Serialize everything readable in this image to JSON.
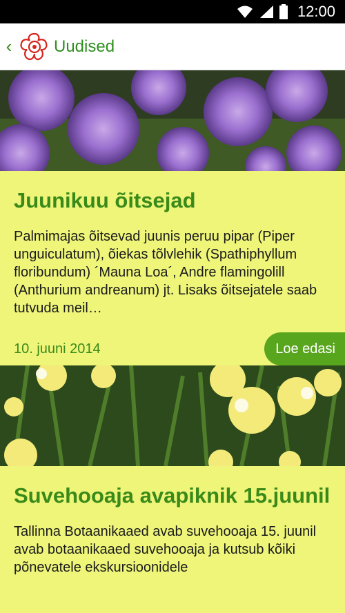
{
  "status_bar": {
    "time": "12:00"
  },
  "app_bar": {
    "title": "Uudised"
  },
  "articles": [
    {
      "title": "Juunikuu õitsejad",
      "text": "Palmimajas õitsevad juunis peruu pipar (Piper unguiculatum), õiekas tõlvlehik (Spathiphyllum floribundum) ´Mauna Loa´, Andre flamingolill (Anthurium andreanum) jt. Lisaks õitsejatele saab tutvuda meil…",
      "date": "10. juuni 2014",
      "read_more": "Loe edasi"
    },
    {
      "title": "Suvehooaja avapiknik 15.juunil",
      "text": "Tallinna Botaanikaaed avab suvehooaja 15. juunil avab botaanikaaed suvehooaja ja kutsub kõiki põnevatele ekskursioonidele"
    }
  ],
  "colors": {
    "accent": "#3a8a1a",
    "card_bg": "#eef579",
    "button": "#58a51e"
  }
}
